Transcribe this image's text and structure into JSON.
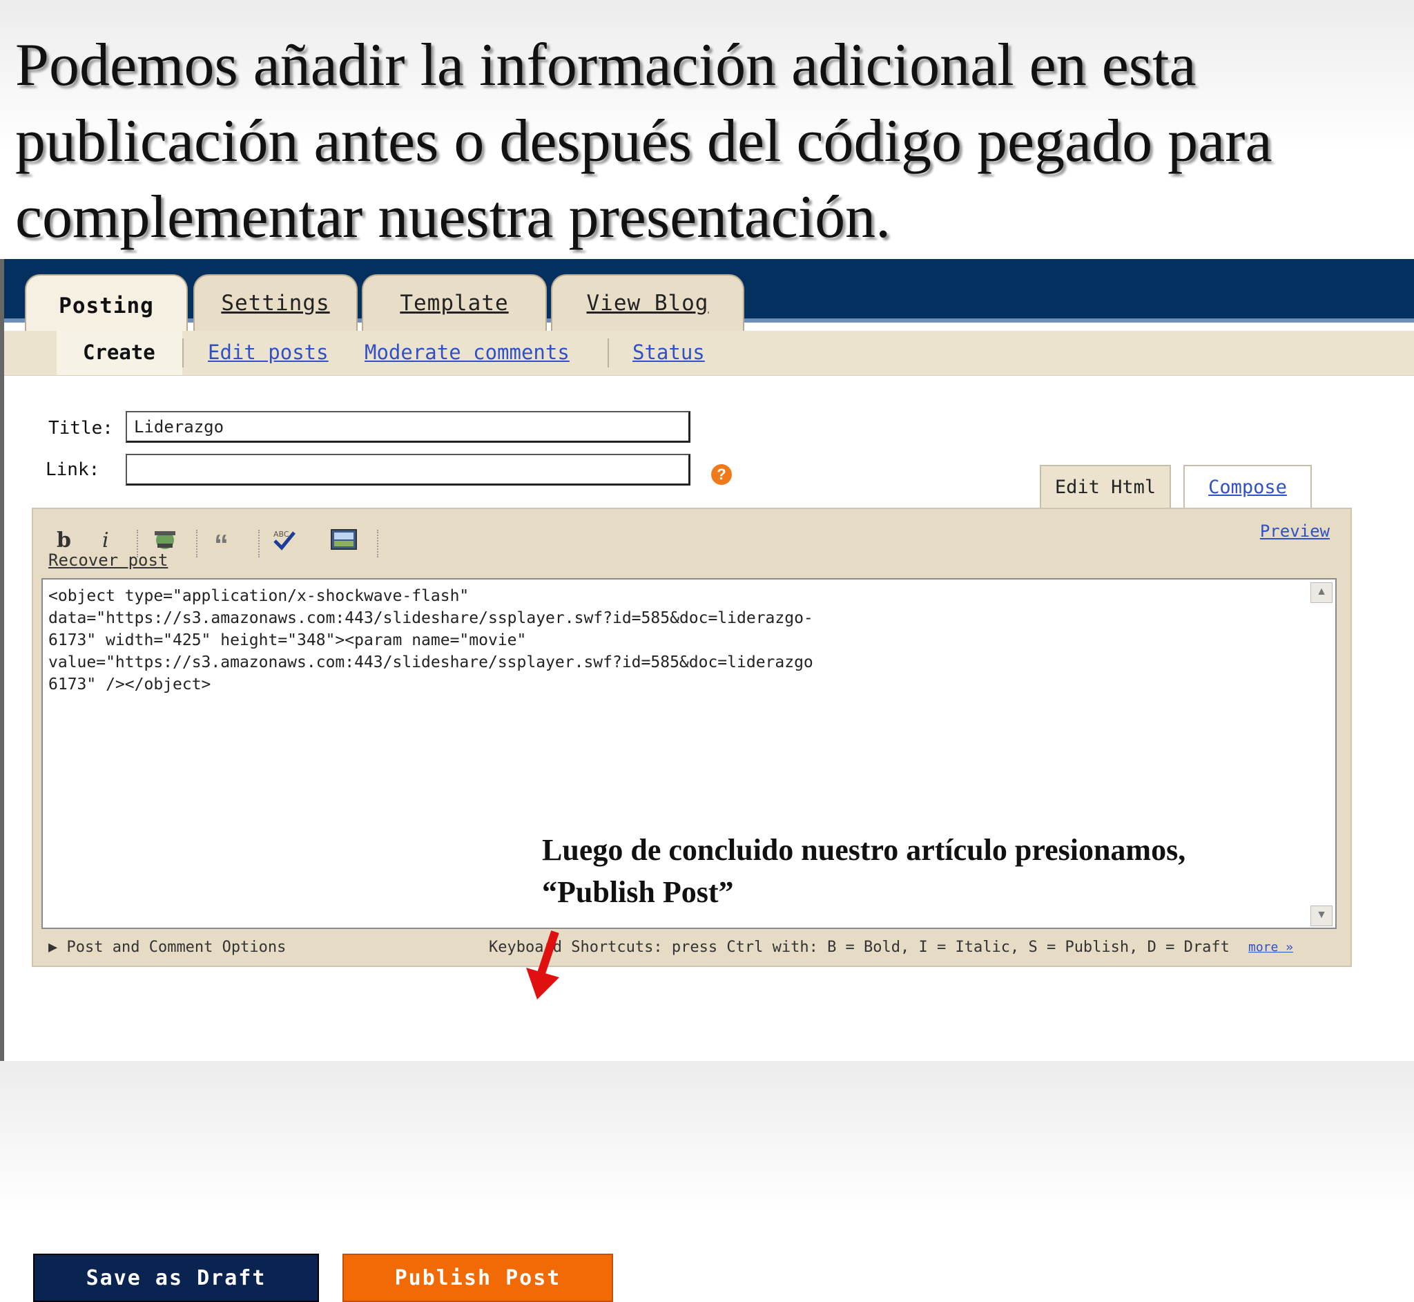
{
  "slide": {
    "title_lines": [
      "Podemos añadir la información adicional en esta",
      "publicación antes o después del código pegado para",
      "complementar nuestra presentación."
    ],
    "annotation_line1": "Luego de concluido nuestro artículo presionamos,",
    "annotation_line2": "“Publish Post”"
  },
  "tabs": [
    {
      "label": "Posting",
      "active": true
    },
    {
      "label": "Settings",
      "active": false
    },
    {
      "label": "Template",
      "active": false
    },
    {
      "label": "View Blog",
      "active": false
    }
  ],
  "subtabs": {
    "create": "Create",
    "edit_posts": "Edit posts",
    "moderate_comments": "Moderate comments",
    "status": "Status"
  },
  "form": {
    "title_label": "Title:",
    "title_value": "Liderazgo",
    "link_label": "Link:",
    "link_value": "",
    "help_icon": "?"
  },
  "editor_modes": {
    "edit_html": "Edit Html",
    "compose": "Compose"
  },
  "toolbar": {
    "bold": "b",
    "italic": "i",
    "link_icon": "link-icon",
    "quote": "“",
    "spellcheck_icon": "spellcheck-icon",
    "image_icon": "image-icon",
    "recover_post": "Recover post",
    "preview": "Preview"
  },
  "editor": {
    "code": "<object type=\"application/x-shockwave-flash\"\ndata=\"https://s3.amazonaws.com:443/slideshare/ssplayer.swf?id=585&doc=liderazgo-\n6173\" width=\"425\" height=\"348\"><param name=\"movie\"\nvalue=\"https://s3.amazonaws.com:443/slideshare/ssplayer.swf?id=585&doc=liderazgo\n6173\" /></object>"
  },
  "footer": {
    "options": "Post and Comment Options",
    "shortcuts": "Keyboard Shortcuts: press Ctrl with: B = Bold, I = Italic, S = Publish, D = Draft",
    "more": "more »"
  },
  "buttons": {
    "save_draft": "Save as Draft",
    "publish": "Publish Post"
  },
  "colors": {
    "topbar": "#04305f",
    "publish": "#f26a05",
    "draft": "#0a2452",
    "arrow": "#e01010"
  }
}
